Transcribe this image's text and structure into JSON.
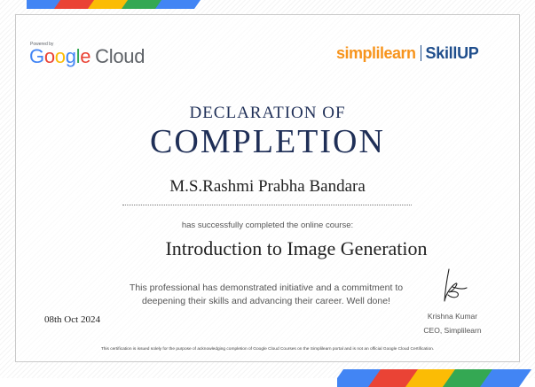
{
  "header": {
    "powered_by": "Powered by",
    "google_letters": [
      "G",
      "o",
      "o",
      "g",
      "l",
      "e"
    ],
    "cloud": "Cloud",
    "simplilearn": "simplilearn",
    "skillup": "SkillUP"
  },
  "certificate": {
    "declaration": "DECLARATION OF",
    "completion": "COMPLETION",
    "recipient": "M.S.Rashmi Prabha Bandara",
    "completed_text": "has successfully completed the online course:",
    "course": "Introduction to Image Generation",
    "paragraph_line1": "This professional has demonstrated initiative and a commitment to",
    "paragraph_line2": "deepening their skills and advancing their career. Well done!",
    "date": "08th Oct 2024",
    "signer_name": "Krishna Kumar",
    "signer_title": "CEO, Simplilearn",
    "disclaimer": "This certification is issued solely for the purpose of acknowledging completion of Google Cloud Courses on the Simplilearn portal and is not an official Google Cloud Certification."
  },
  "colors": {
    "google_blue": "#4285F4",
    "google_red": "#EA4335",
    "google_yellow": "#FBBC05",
    "google_green": "#34A853",
    "navy": "#1f2f57",
    "simplilearn_orange": "#f7941d",
    "skillup_blue": "#1f4e8c"
  }
}
